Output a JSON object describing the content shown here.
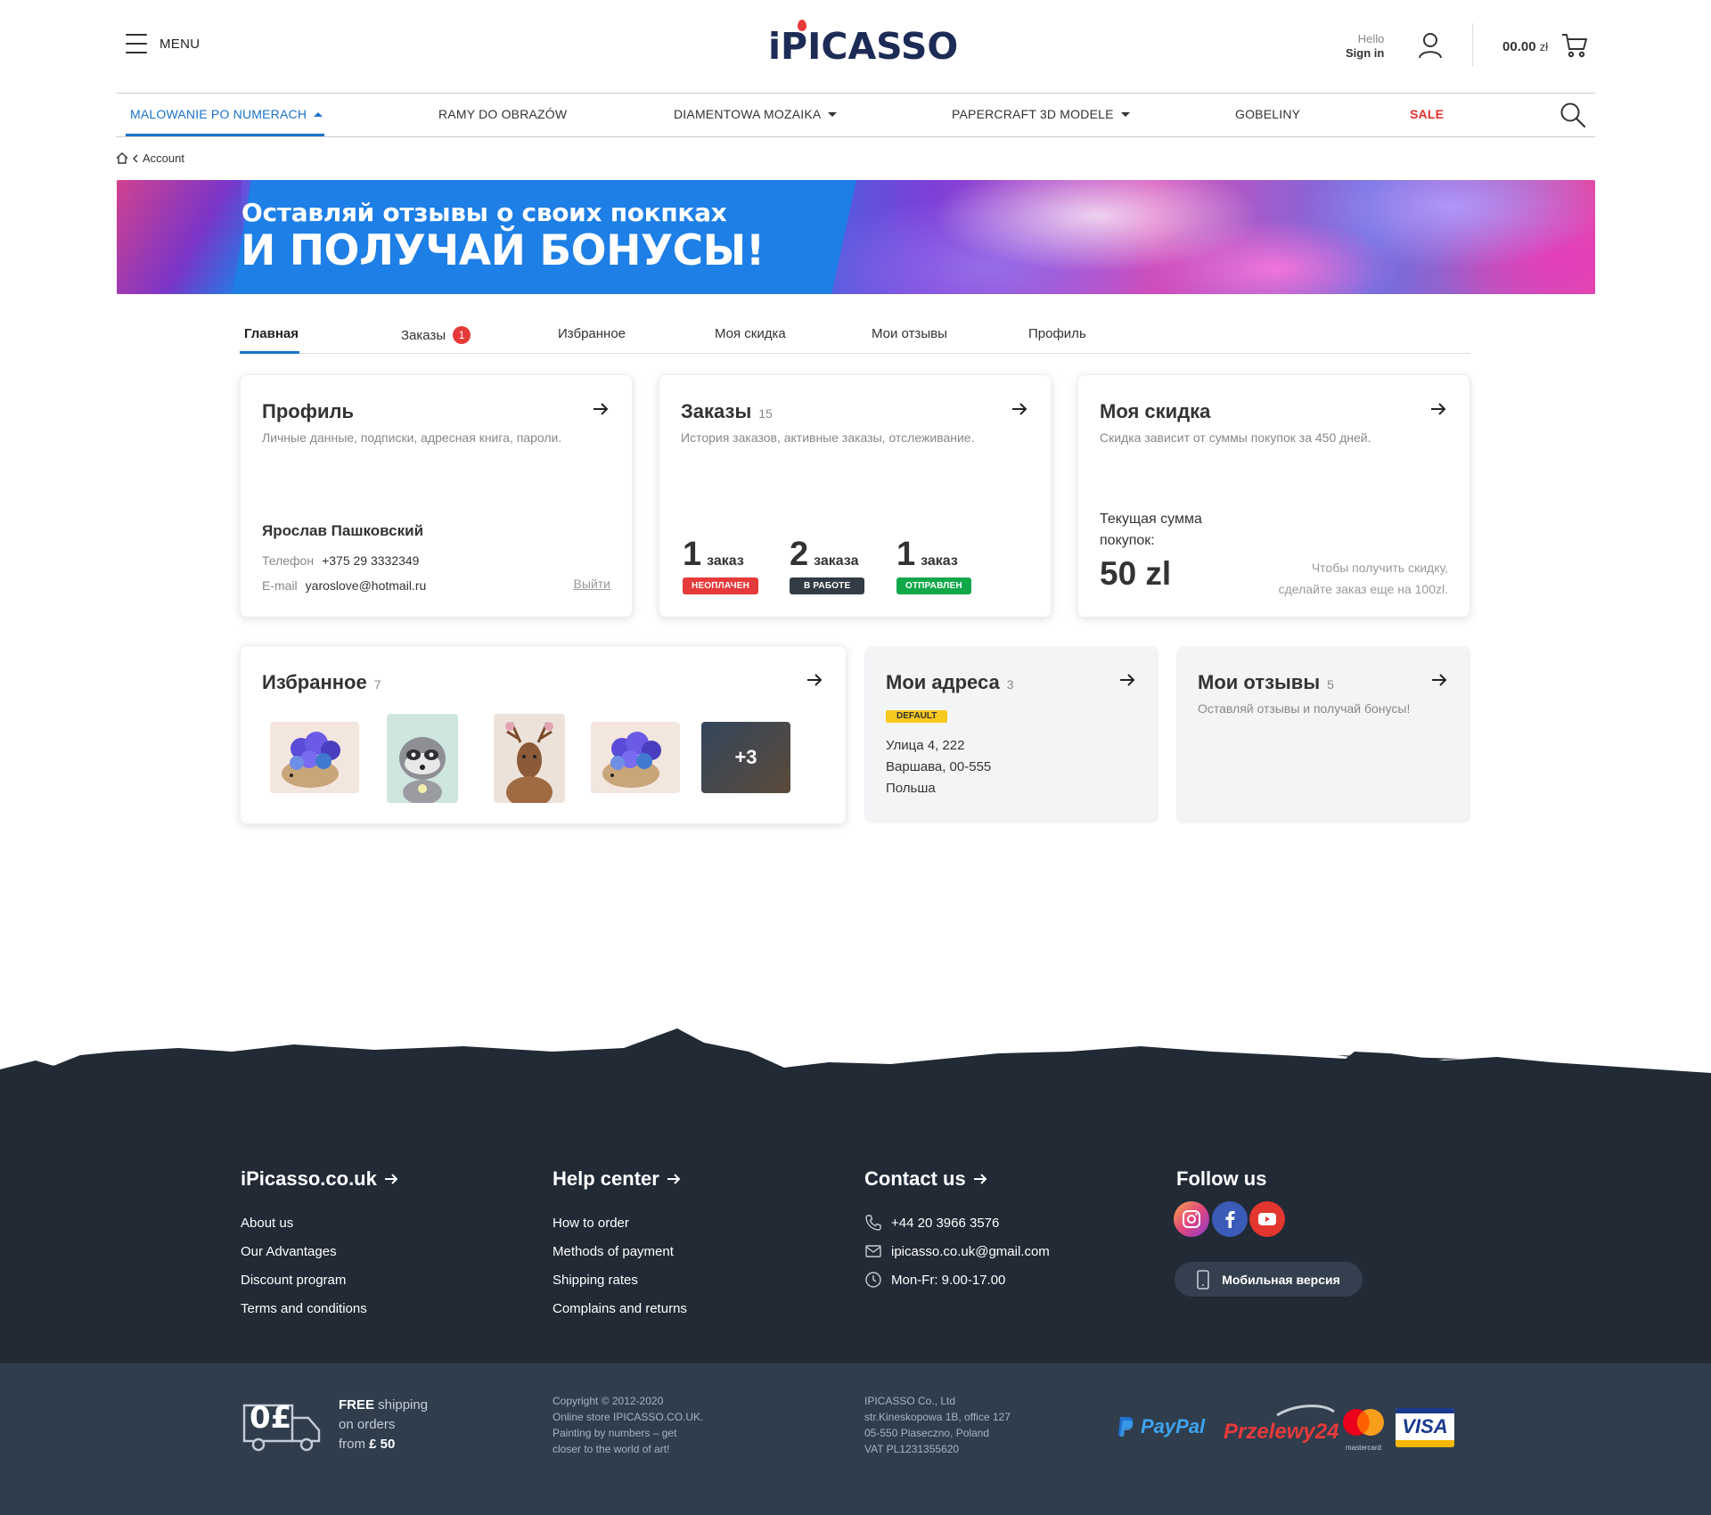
{
  "header": {
    "menu_label": "MENU",
    "logo_text": "iPICASSO",
    "signin_hello": "Hello",
    "signin_label": "Sign in",
    "cart_total": "00.00",
    "cart_currency": "zł"
  },
  "nav": {
    "items": [
      {
        "label": "MALOWANIE PO NUMERACH"
      },
      {
        "label": "RAMY DO OBRAZÓW"
      },
      {
        "label": "DIAMENTOWA MOZAIKA"
      },
      {
        "label": "PAPERCRAFT 3D MODELE"
      },
      {
        "label": "GOBELINY"
      },
      {
        "label": "SALE"
      }
    ]
  },
  "breadcrumb": {
    "label": "Account"
  },
  "banner": {
    "line1": "Оставляй отзывы о своих покпках",
    "line2": "И ПОЛУЧАЙ БОНУСЫ!"
  },
  "tabs": [
    {
      "label": "Главная"
    },
    {
      "label": "Заказы",
      "badge": "1"
    },
    {
      "label": "Избранное"
    },
    {
      "label": "Моя скидка"
    },
    {
      "label": "Мои отзывы"
    },
    {
      "label": "Профиль"
    }
  ],
  "profile": {
    "title": "Профиль",
    "subtitle": "Личные данные, подписки, адресная книга, пароли.",
    "name": "Ярослав Пашковский",
    "phone_label": "Телефон",
    "phone": "+375 29 3332349",
    "email_label": "E-mail",
    "email": "yaroslove@hotmail.ru",
    "logout": "Выйти"
  },
  "orders": {
    "title": "Заказы",
    "count": "15",
    "subtitle": "История заказов, активные заказы, отслеживание.",
    "groups": [
      {
        "num": "1",
        "word": "заказ",
        "status": "НЕОПЛАЧЕН"
      },
      {
        "num": "2",
        "word": "заказа",
        "status": "В РАБОТЕ"
      },
      {
        "num": "1",
        "word": "заказ",
        "status": "ОТПРАВЛЕН"
      }
    ]
  },
  "discount": {
    "title": "Моя скидка",
    "subtitle": "Скидка зависит от суммы покупок за 450 дней.",
    "current_label": "Текущая сумма покупок:",
    "current_sum": "50 zl",
    "hint_line1": "Чтобы получить скидку,",
    "hint_line2": "сделайте заказ еще на 100zl."
  },
  "favorites": {
    "title": "Избранное",
    "count": "7",
    "more": "+3"
  },
  "addresses": {
    "title": "Мои адреса",
    "count": "3",
    "badge": "DEFAULT",
    "line1": "Улица 4, 222",
    "line2": "Варшава, 00-555",
    "line3": "Польша"
  },
  "reviews": {
    "title": "Мои отзывы",
    "count": "5",
    "subtitle": "Оставляй отзывы и получай бонусы!"
  },
  "footer": {
    "col1": {
      "title": "iPicasso.co.uk",
      "links": [
        "About us",
        "Our Advantages",
        "Discount program",
        "Terms and conditions"
      ]
    },
    "col2": {
      "title": "Help center",
      "links": [
        "How to order",
        "Methods of payment",
        "Shipping rates",
        "Complains and returns"
      ]
    },
    "col3": {
      "title": "Contact us",
      "phone": "+44 20 3966 3576",
      "email": "ipicasso.co.uk@gmail.com",
      "hours": "Mon-Fr: 9.00-17.00"
    },
    "col4": {
      "title": "Follow us",
      "mobile": "Мобильная версия"
    },
    "shipping": {
      "icon_text": "0£",
      "free": "FREE",
      "line1": " shipping",
      "line2": "on orders",
      "line3": "from ",
      "amount": "£ 50"
    },
    "copyright": [
      "Copyright © 2012-2020",
      "Online store IPICASSO.CO.UK.",
      "Painting by numbers – get",
      "closer to the world of art!"
    ],
    "company": [
      "IPICASSO Co., Ltd",
      "str.Kineskopowa 1B, office 127",
      "05-550 Piaseczno, Poland",
      "VAT PL1231355620"
    ],
    "payments": [
      "PayPal",
      "Przelewy24",
      "mastercard",
      "VISA"
    ]
  },
  "colors": {
    "accent": "#1a73c9",
    "sale": "#e0302b",
    "footer": "#212a35",
    "footer_bottom": "#2f3d4d"
  }
}
